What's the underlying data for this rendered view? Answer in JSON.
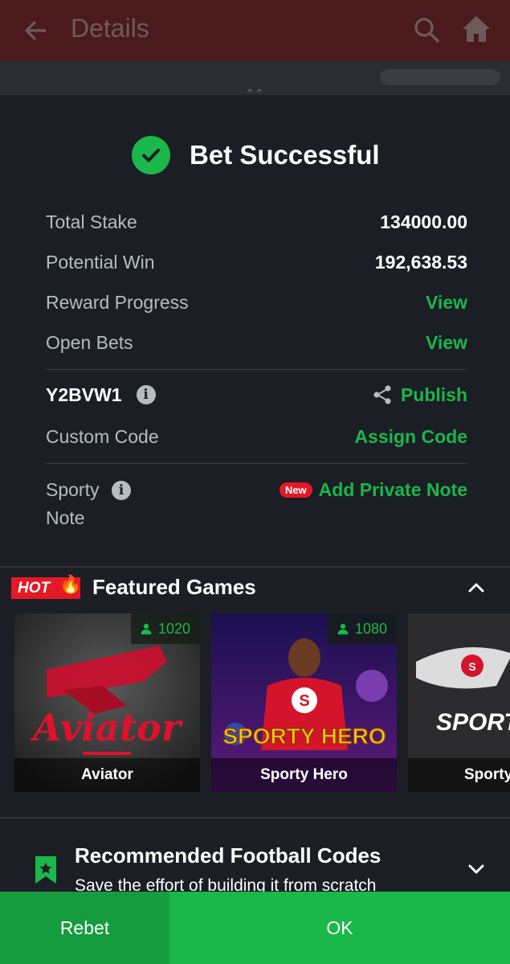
{
  "topbar": {
    "title": "Details"
  },
  "sheet": {
    "heading": "Bet Successful",
    "summary": [
      {
        "label": "Total Stake",
        "value": "134000.00"
      },
      {
        "label": "Potential Win",
        "value": "192,638.53"
      },
      {
        "label": "Reward Progress",
        "link": "View"
      },
      {
        "label": "Open Bets",
        "link": "View"
      }
    ],
    "booking_code": "Y2BVW1",
    "publish_label": "Publish",
    "custom_code_label": "Custom Code",
    "assign_code_label": "Assign Code",
    "note_label_line1": "Sporty",
    "note_label_line2": "Note",
    "new_badge": "New",
    "add_note_label": "Add Private Note"
  },
  "featured": {
    "hot_label": "HOT",
    "title": "Featured Games",
    "games": [
      {
        "name": "Aviator",
        "players": "1020",
        "art_text": "Aviator"
      },
      {
        "name": "Sporty Hero",
        "players": "1080",
        "art_text": "SPORTY HERO"
      },
      {
        "name": "Sporty",
        "art_text": "SPORTY JET"
      }
    ]
  },
  "recommended": {
    "title": "Recommended Football Codes",
    "subtitle": "Save the effort of building it from scratch"
  },
  "actions": {
    "rebet": "Rebet",
    "ok": "OK"
  },
  "colors": {
    "accent": "#1ab74a",
    "hot": "#e41827",
    "topbar": "#4a1a1d",
    "background": "#1b1e25"
  }
}
